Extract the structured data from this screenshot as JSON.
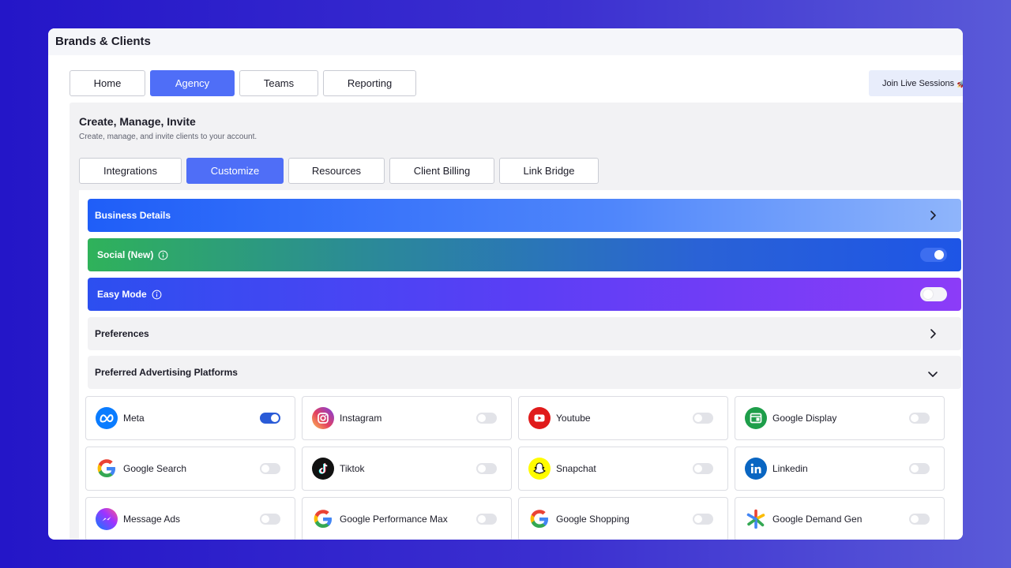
{
  "window": {
    "title": "Brands & Clients"
  },
  "top_tabs": [
    {
      "label": "Home",
      "active": false
    },
    {
      "label": "Agency",
      "active": true
    },
    {
      "label": "Teams",
      "active": false
    },
    {
      "label": "Reporting",
      "active": false
    }
  ],
  "live_sessions": {
    "label": "Join Live Sessions 🚀"
  },
  "section": {
    "title": "Create, Manage, Invite",
    "subtitle": "Create, manage, and invite clients to your account."
  },
  "sub_tabs": [
    {
      "label": "Integrations",
      "active": false
    },
    {
      "label": "Customize",
      "active": true
    },
    {
      "label": "Resources",
      "active": false
    },
    {
      "label": "Client Billing",
      "active": false
    },
    {
      "label": "Link Bridge",
      "active": false
    }
  ],
  "bars": {
    "business": {
      "label": "Business Details"
    },
    "social": {
      "label": "Social (New)",
      "enabled": true
    },
    "easy": {
      "label": "Easy Mode",
      "enabled": false
    },
    "preferences": {
      "label": "Preferences"
    },
    "platforms": {
      "label": "Preferred Advertising Platforms"
    }
  },
  "platforms": [
    {
      "name": "Meta",
      "icon": "meta-icon",
      "enabled": true
    },
    {
      "name": "Instagram",
      "icon": "instagram-icon",
      "enabled": false
    },
    {
      "name": "Youtube",
      "icon": "youtube-icon",
      "enabled": false
    },
    {
      "name": "Google Display",
      "icon": "google-display-icon",
      "enabled": false
    },
    {
      "name": "Google Search",
      "icon": "google-icon",
      "enabled": false
    },
    {
      "name": "Tiktok",
      "icon": "tiktok-icon",
      "enabled": false
    },
    {
      "name": "Snapchat",
      "icon": "snapchat-icon",
      "enabled": false
    },
    {
      "name": "Linkedin",
      "icon": "linkedin-icon",
      "enabled": false
    },
    {
      "name": "Message Ads",
      "icon": "messenger-icon",
      "enabled": false
    },
    {
      "name": "Google Performance Max",
      "icon": "google-icon",
      "enabled": false
    },
    {
      "name": "Google Shopping",
      "icon": "google-icon",
      "enabled": false
    },
    {
      "name": "Google Demand Gen",
      "icon": "google-demand-gen-icon",
      "enabled": false
    }
  ],
  "colors": {
    "accent": "#4f6ef7",
    "toggle_on": "#2a5bd7",
    "background_start": "#2416c8",
    "background_end": "#5a5ad8"
  }
}
